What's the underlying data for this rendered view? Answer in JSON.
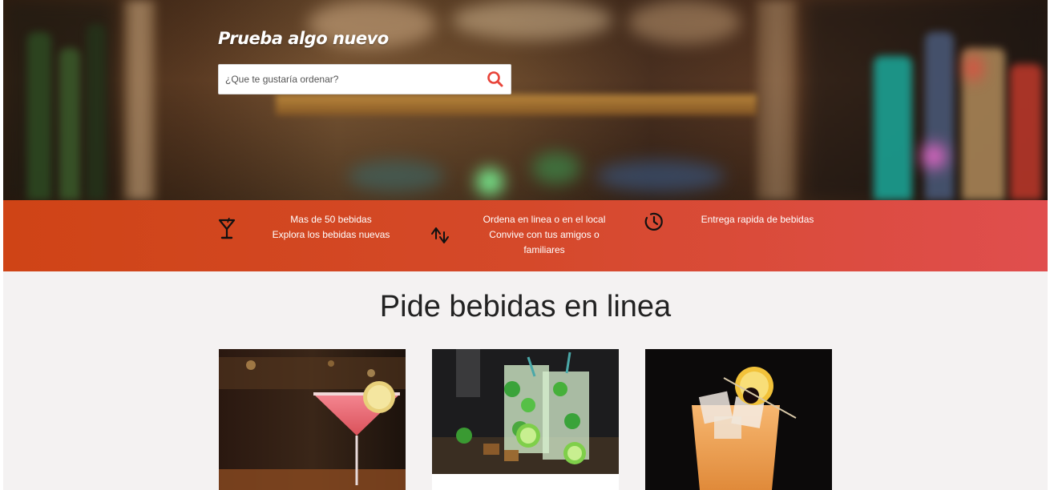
{
  "hero": {
    "title": "Prueba algo nuevo",
    "search": {
      "placeholder": "¿Que te gustaría ordenar?",
      "value": "",
      "button_icon": "search-icon"
    }
  },
  "features": [
    {
      "icon": "cocktail-glass-icon",
      "lines": [
        "Mas de 50 bebidas",
        "Explora los bebidas nuevas"
      ]
    },
    {
      "icon": "swap-arrows-icon",
      "lines": [
        "Ordena en linea o en el local",
        "Convive con tus amigos o",
        "familiares"
      ]
    },
    {
      "icon": "clock-icon",
      "lines": [
        "Entrega rapida de bebidas"
      ]
    }
  ],
  "main": {
    "title": "Pide bebidas en linea",
    "cards": [
      {
        "image": "pink-martini-cocktail"
      },
      {
        "image": "mojito-glasses"
      },
      {
        "image": "orange-iced-cocktail"
      }
    ]
  },
  "colors": {
    "band_start": "#cf4416",
    "band_end": "#e04e4e",
    "search_icon": "#e8443a",
    "page_bg": "#f4f2f2",
    "title_text": "#222222"
  }
}
